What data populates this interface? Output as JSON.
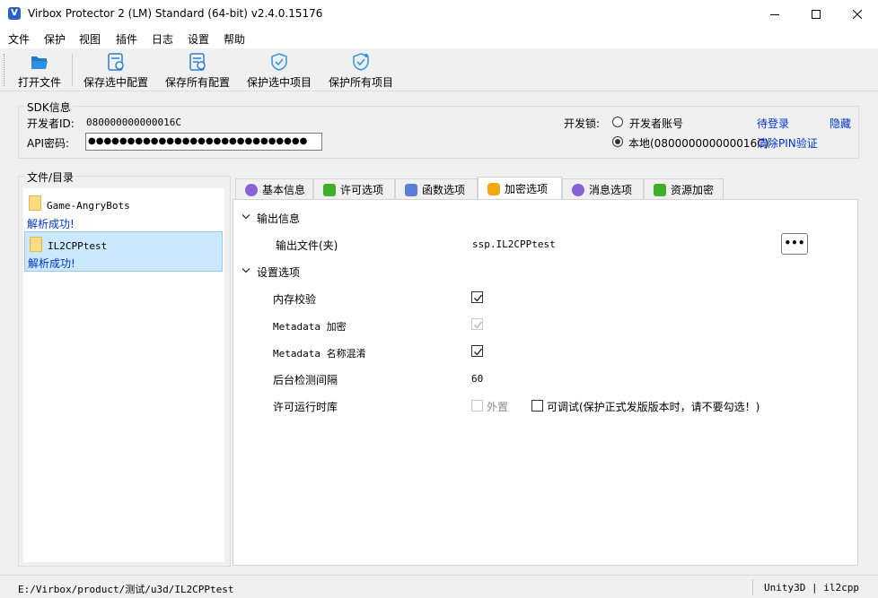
{
  "window": {
    "title": "Virbox Protector 2 (LM) Standard (64-bit) v2.4.0.15176",
    "icon_letter": "V",
    "controls": [
      "minimize-icon",
      "maximize-icon",
      "close-icon"
    ]
  },
  "menu": [
    "文件",
    "保护",
    "视图",
    "插件",
    "日志",
    "设置",
    "帮助"
  ],
  "toolbar": {
    "open_file": "打开文件",
    "save_selected_config": "保存选中配置",
    "save_all_config": "保存所有配置",
    "protect_selected": "保护选中项目",
    "protect_all": "保护所有项目"
  },
  "sdk": {
    "legend": "SDK信息",
    "developer_id_label": "开发者ID:",
    "developer_id": "080000000000016C",
    "api_password_label": "API密码:",
    "api_password": "●●●●●●●●●●●●●●●●●●●●●●●●●●●●",
    "lock_label": "开发锁:",
    "option_account": "开发者账号",
    "option_local": "本地(080000000000016C)",
    "pending_login": "待登录",
    "hide": "隐藏",
    "clear_pin": "清除PIN验证",
    "selected_option": "local"
  },
  "files": {
    "legend": "文件/目录",
    "items": [
      {
        "name": "Game-AngryBots",
        "status": "解析成功!",
        "selected": false
      },
      {
        "name": "IL2CPPtest",
        "status": "解析成功!",
        "selected": true
      }
    ]
  },
  "tabs": [
    {
      "label": "基本信息",
      "icon": "chat-icon",
      "color": "#8a62d6"
    },
    {
      "label": "许可选项",
      "icon": "shield-check-icon",
      "color": "#3fae2a"
    },
    {
      "label": "函数选项",
      "icon": "function-icon",
      "color": "#5a7fd6"
    },
    {
      "label": "加密选项",
      "icon": "lock-icon",
      "color": "#f3a712",
      "active": true
    },
    {
      "label": "消息选项",
      "icon": "chat-icon",
      "color": "#8a62d6"
    },
    {
      "label": "资源加密",
      "icon": "shield-check-icon",
      "color": "#3fae2a"
    }
  ],
  "encryption": {
    "output_section": "输出信息",
    "output_file_label": "输出文件(夹)",
    "output_file_value": "ssp.IL2CPPtest",
    "browse_label": "•••",
    "settings_section": "设置选项",
    "memory_check_label": "内存校验",
    "memory_check": true,
    "metadata_encrypt_label": "Metadata 加密",
    "metadata_encrypt": true,
    "metadata_obfuscate_label": "Metadata 名称混淆",
    "metadata_obfuscate": true,
    "bg_interval_label": "后台检测间隔",
    "bg_interval_value": "60",
    "runtime_label": "许可运行时库",
    "runtime_external": "外置",
    "runtime_debug": "可调试(保护正式发版版本时，请不要勾选！)",
    "runtime_external_checked": false,
    "runtime_debug_checked": false
  },
  "status": {
    "path": "E:/Virbox/product/测试/u3d/IL2CPPtest",
    "engine": "Unity3D | il2cpp"
  }
}
